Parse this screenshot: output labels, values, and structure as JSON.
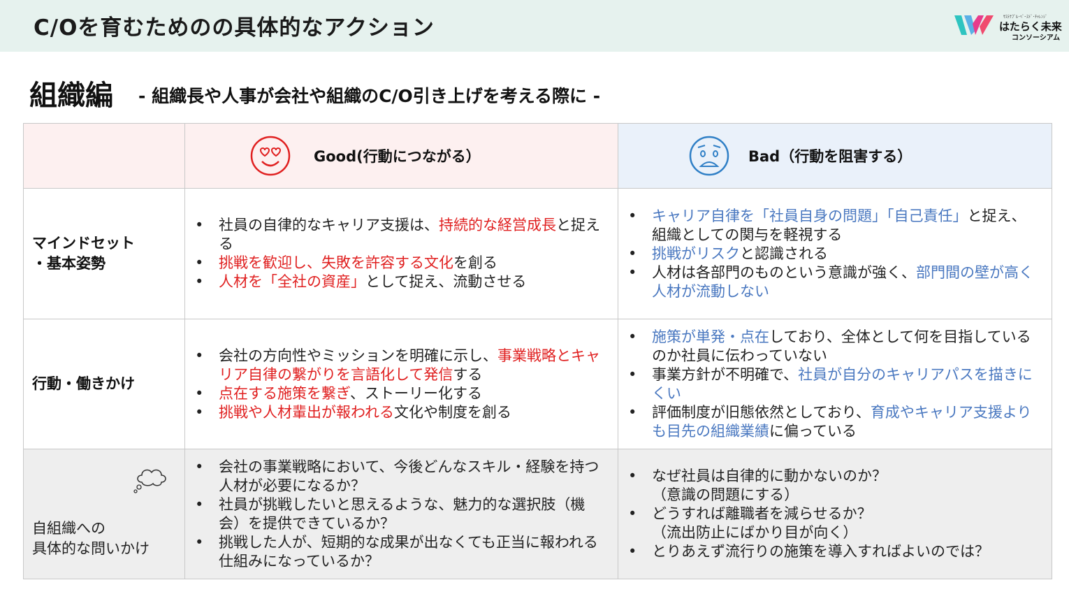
{
  "header": {
    "title": "C/Oを育むためのの具体的なアクション"
  },
  "logo": {
    "small": "ｻｽﾃﾅﾌﾞﾙ･ﾍﾞｰｽﾄﾞ･ﾁｬﾚﾝｼﾞ",
    "main": "はたらく未来",
    "sub": "コンソーシアム"
  },
  "section": {
    "title": "組織編",
    "subtitle": "- 組織長や人事が会社や組織のC/O引き上げを考える際に -"
  },
  "table": {
    "good_header": "Good(行動につながる）",
    "bad_header": "Bad（行動を阻害する）",
    "rows": [
      {
        "label_line1": "マインドセット",
        "label_line2": "・基本姿勢"
      },
      {
        "label_line1": "行動・働きかけ"
      },
      {
        "label_line1": "自組織への",
        "label_line2": "具体的な問いかけ"
      }
    ]
  },
  "content": {
    "r1g": [
      [
        "社員の自律的なキャリア支援は、",
        "持続的な経営成長",
        "と捉える"
      ],
      [
        "挑戦を歓迎し、失敗を許容する文化",
        "を創る"
      ],
      [
        "人材を「全社の資産」",
        "として捉え、流動させる"
      ]
    ],
    "r1b": [
      [
        "キャリア自律を「社員自身の問題」「自己責任」",
        "と捉え、組織としての関与を軽視する"
      ],
      [
        "挑戦がリスク",
        "と認識される"
      ],
      [
        "人材は各部門のものという意識が強く、",
        "部門間の壁が高く人材が流動しない"
      ]
    ],
    "r2g": [
      [
        "会社の方向性やミッションを明確に示し、",
        "事業戦略とキャリア自律の繋がりを言語化して発信",
        "する"
      ],
      [
        "点在する施策を繋ぎ",
        "、ストーリー化する"
      ],
      [
        "挑戦や人材輩出が報われる",
        "文化や制度を創る"
      ]
    ],
    "r2b": [
      [
        "施策が単発・点在",
        "しており、全体として何を目指しているのか社員に伝わっていない"
      ],
      [
        "事業方針が不明確で、",
        "社員が自分のキャリアパスを描きにくい"
      ],
      [
        "評価制度が旧態依然としており、",
        "育成やキャリア支援よりも目先の組織業績",
        "に偏っている"
      ]
    ],
    "r3g": [
      "会社の事業戦略において、今後どんなスキル・経験を持つ人材が必要になるか？",
      "社員が挑戦したいと思えるような、魅力的な選択肢（機会）を提供できているか？",
      "挑戦した人が、短期的な成果が出なくても正当に報われる仕組みになっているか？"
    ],
    "r3b": [
      [
        "なぜ社員は自律的に動かないのか？",
        "（意識の問題にする）"
      ],
      [
        "どうすれば離職者を減らせるか？",
        "（流出防止にばかり目が向く）"
      ],
      [
        "とりあえず流行りの施策を導入すればよいのでは？"
      ]
    ]
  },
  "colors": {
    "header_bg": "#e6f2ee",
    "good_bg": "#fdf0f0",
    "bad_bg": "#eaf1fa",
    "highlight_red": "#e02020",
    "highlight_blue": "#4a78c0",
    "question_bg": "#eeeeee"
  },
  "icons": {
    "good": "heart-eyes-face-icon",
    "bad": "worried-face-icon",
    "thought": "thought-cloud-icon"
  }
}
